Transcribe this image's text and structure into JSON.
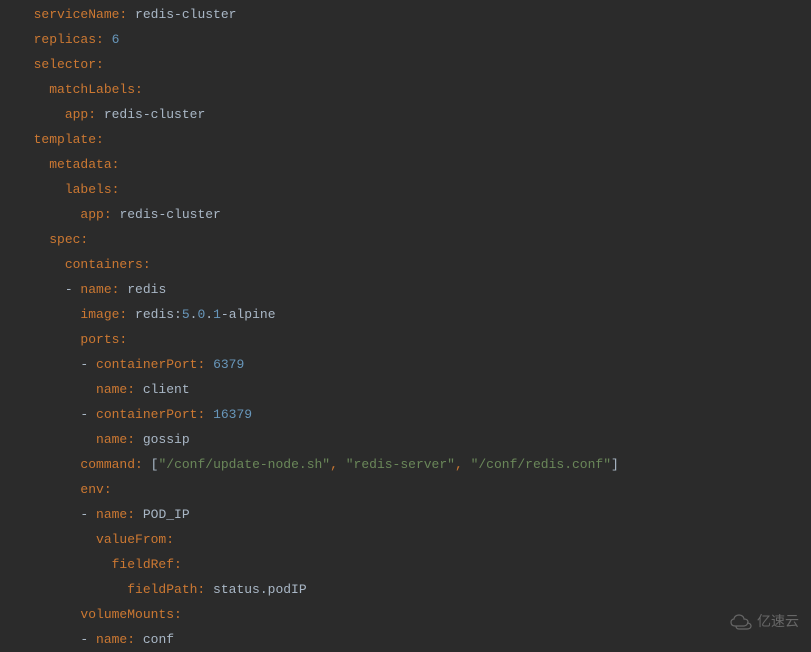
{
  "code": {
    "l1": {
      "indent": "  ",
      "key": "serviceName:",
      "value": " redis-cluster"
    },
    "l2": {
      "indent": "  ",
      "key": "replicas:",
      "value": " ",
      "num": "6"
    },
    "l3": {
      "indent": "  ",
      "key": "selector:"
    },
    "l4": {
      "indent": "    ",
      "key": "matchLabels:"
    },
    "l5": {
      "indent": "      ",
      "key": "app:",
      "value": " redis-cluster"
    },
    "l6": {
      "indent": "  ",
      "key": "template:"
    },
    "l7": {
      "indent": "    ",
      "key": "metadata:"
    },
    "l8": {
      "indent": "      ",
      "key": "labels:"
    },
    "l9": {
      "indent": "        ",
      "key": "app:",
      "value": " redis-cluster"
    },
    "l10": {
      "indent": "    ",
      "key": "spec:"
    },
    "l11": {
      "indent": "      ",
      "key": "containers:"
    },
    "l12": {
      "indent": "      ",
      "dash": "- ",
      "key": "name:",
      "value": " redis"
    },
    "l13": {
      "indent": "        ",
      "key": "image:",
      "value": " redis:",
      "n1": "5",
      "d1": ".",
      "n2": "0",
      "d2": ".",
      "n3": "1",
      "rest": "-alpine"
    },
    "l14": {
      "indent": "        ",
      "key": "ports:"
    },
    "l15": {
      "indent": "        ",
      "dash": "- ",
      "key": "containerPort:",
      "value": " ",
      "num": "6379"
    },
    "l16": {
      "indent": "          ",
      "key": "name:",
      "value": " client"
    },
    "l17": {
      "indent": "        ",
      "dash": "- ",
      "key": "containerPort:",
      "value": " ",
      "num": "16379"
    },
    "l18": {
      "indent": "          ",
      "key": "name:",
      "value": " gossip"
    },
    "l19": {
      "indent": "        ",
      "key": "command:",
      "sp": " ",
      "lb": "[",
      "s1": "\"/conf/update-node.sh\"",
      "c1": ",",
      "sp1": " ",
      "s2": "\"redis-server\"",
      "c2": ",",
      "sp2": " ",
      "s3": "\"/conf/redis.conf\"",
      "rb": "]"
    },
    "l20": {
      "indent": "        ",
      "key": "env:"
    },
    "l21": {
      "indent": "        ",
      "dash": "- ",
      "key": "name:",
      "value": " POD_IP"
    },
    "l22": {
      "indent": "          ",
      "key": "valueFrom:"
    },
    "l23": {
      "indent": "            ",
      "key": "fieldRef:"
    },
    "l24": {
      "indent": "              ",
      "key": "fieldPath:",
      "value": " status.podIP"
    },
    "l25": {
      "indent": "        ",
      "key": "volumeMounts:"
    },
    "l26": {
      "indent": "        ",
      "dash": "- ",
      "key": "name:",
      "value": " conf"
    }
  },
  "watermark": {
    "text": "亿速云"
  }
}
